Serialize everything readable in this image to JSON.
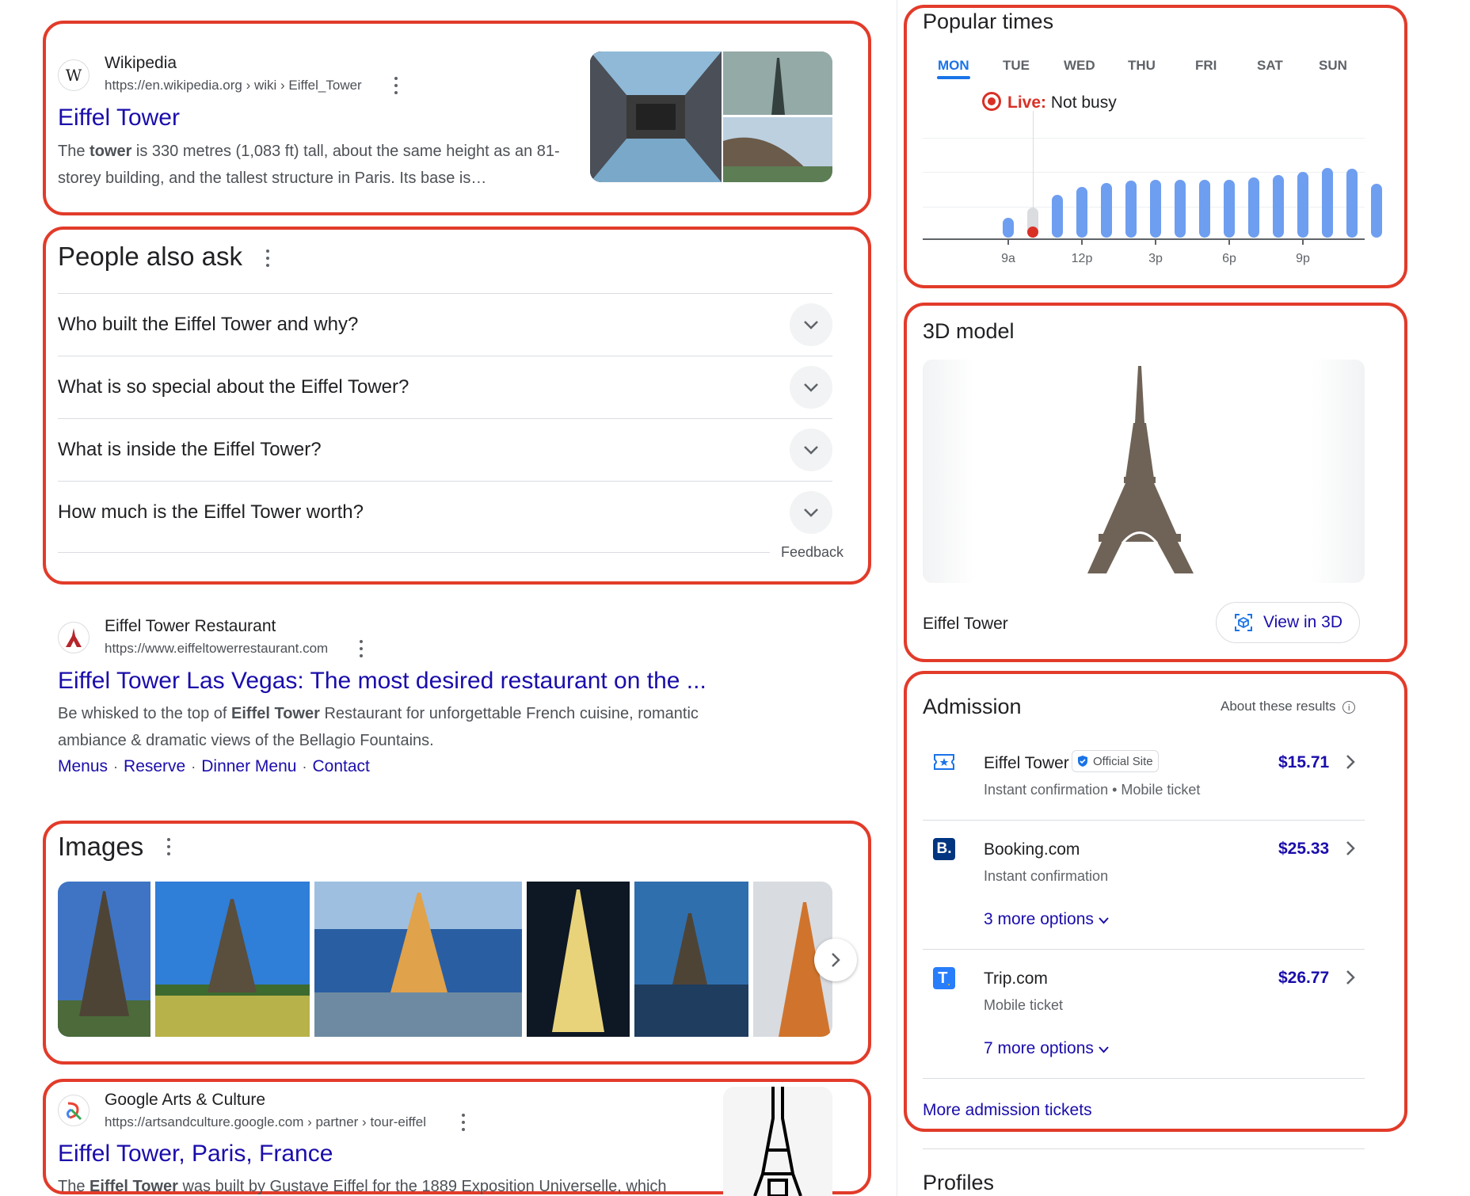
{
  "wiki": {
    "site": "Wikipedia",
    "url": "https://en.wikipedia.org › wiki › Eiffel_Tower",
    "title": "Eiffel Tower",
    "snippet_pre": "The ",
    "snippet_bold": "tower",
    "snippet_post": " is 330 metres (1,083 ft) tall, about the same height as an 81-storey building, and the tallest structure in Paris. Its base is…",
    "favicon": "W"
  },
  "paa": {
    "heading": "People also ask",
    "questions": [
      "Who built the Eiffel Tower and why?",
      "What is so special about the Eiffel Tower?",
      "What is inside the Eiffel Tower?",
      "How much is the Eiffel Tower worth?"
    ],
    "feedback": "Feedback"
  },
  "restaurant": {
    "site": "Eiffel Tower Restaurant",
    "url": "https://www.eiffeltowerrestaurant.com",
    "title": "Eiffel Tower Las Vegas: The most desired restaurant on the ...",
    "snippet_pre": "Be whisked to the top of ",
    "snippet_bold": "Eiffel Tower",
    "snippet_post": " Restaurant for unforgettable French cuisine, romantic ambiance & dramatic views of the Bellagio Fountains.",
    "sitelinks": [
      "Menus",
      "Reserve",
      "Dinner Menu",
      "Contact"
    ]
  },
  "images": {
    "heading": "Images"
  },
  "arts": {
    "site": "Google Arts & Culture",
    "url": "https://artsandculture.google.com › partner › tour-eiffel",
    "title": "Eiffel Tower, Paris, France",
    "snippet_pre": "The ",
    "snippet_bold": "Eiffel Tower",
    "snippet_post": " was built by Gustave Eiffel for the 1889 Exposition Universelle, which"
  },
  "popular_times": {
    "heading": "Popular times",
    "days": [
      "MON",
      "TUE",
      "WED",
      "THU",
      "FRI",
      "SAT",
      "SUN"
    ],
    "selected_day": "MON",
    "live_label": "Live:",
    "live_status": "Not busy",
    "ticks": [
      "9a",
      "12p",
      "3p",
      "6p",
      "9p"
    ],
    "hours_busyness": [
      0.2,
      0.3,
      0.43,
      0.51,
      0.55,
      0.57,
      0.58,
      0.58,
      0.58,
      0.58,
      0.6,
      0.63,
      0.66,
      0.7,
      0.69,
      0.54
    ],
    "live_index": 1,
    "live_level": 0.06
  },
  "model3d": {
    "heading": "3D model",
    "caption": "Eiffel Tower",
    "button": "View in 3D"
  },
  "admission": {
    "heading": "Admission",
    "about": "About these results",
    "offers": [
      {
        "vendor": "Eiffel Tower",
        "badge": "Official Site",
        "details": "Instant confirmation • Mobile ticket",
        "price": "$15.71",
        "more": ""
      },
      {
        "vendor": "Booking.com",
        "badge": "",
        "details": "Instant confirmation",
        "price": "$25.33",
        "more": "3 more options"
      },
      {
        "vendor": "Trip.com",
        "badge": "",
        "details": "Mobile ticket",
        "price": "$26.77",
        "more": "7 more options"
      }
    ],
    "more_link": "More admission tickets"
  },
  "profiles": {
    "heading": "Profiles"
  },
  "colors": {
    "link": "#1a0dab",
    "highlight_box": "#e23b2a",
    "bar": "#6e9ef0",
    "live": "#d93025"
  }
}
